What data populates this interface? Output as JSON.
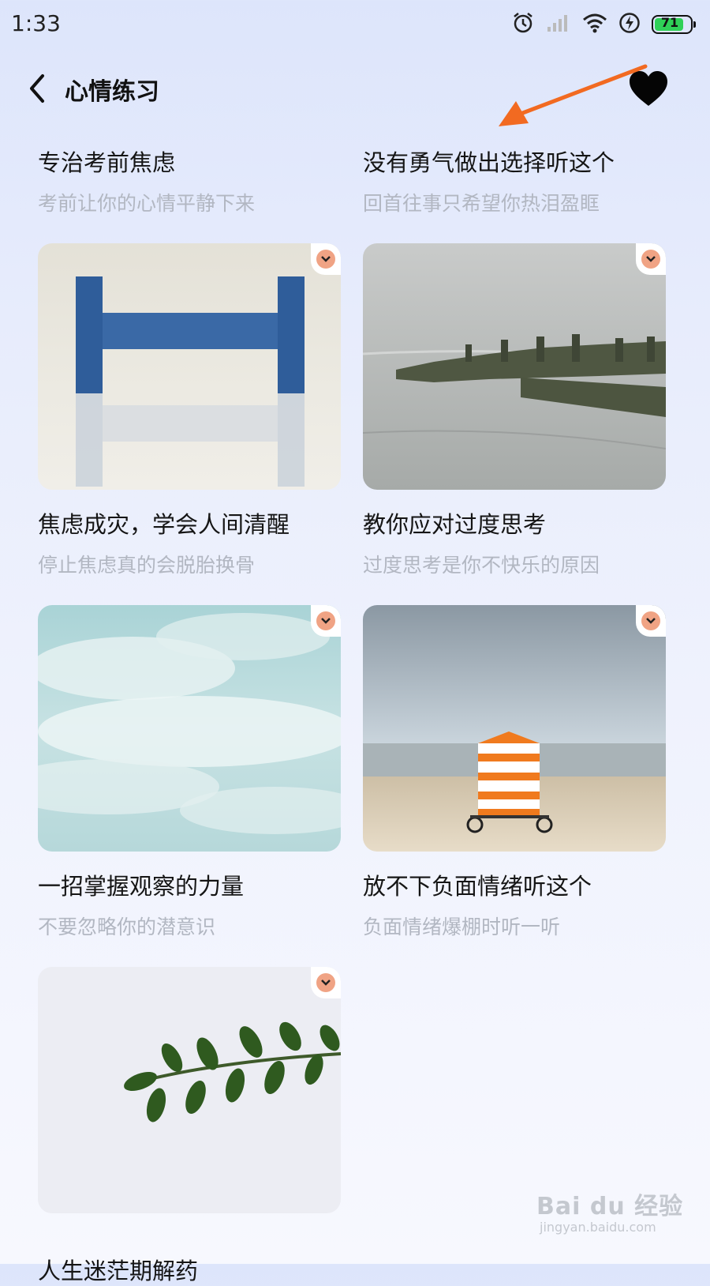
{
  "status_bar": {
    "time": "1:33",
    "battery": "71",
    "icons": [
      "alarm-icon",
      "signal-icon",
      "wifi-icon",
      "charging-icon",
      "battery-icon"
    ]
  },
  "header": {
    "title": "心情练习",
    "back_icon": "chevron-left-icon",
    "favorite_icon": "heart-icon"
  },
  "accent_colors": {
    "badge": "#f0a384",
    "annotation_arrow": "#f26a21",
    "subtitle": "#b2b7c2"
  },
  "cards": [
    {
      "title": "专治考前焦虑",
      "subtitle": "考前让你的心情平静下来"
    },
    {
      "title": "没有勇气做出选择听这个",
      "subtitle": "回首往事只希望你热泪盈眶"
    },
    {
      "title": "焦虑成灾，学会人间清醒",
      "subtitle": "停止焦虑真的会脱胎换骨",
      "image": "blue-wooden-stool"
    },
    {
      "title": "教你应对过度思考",
      "subtitle": "过度思考是你不快乐的原因",
      "image": "sea-breakwater-posts"
    },
    {
      "title": "一招掌握观察的力量",
      "subtitle": "不要忽略你的潜意识",
      "image": "cloudy-sky"
    },
    {
      "title": "放不下负面情绪听这个",
      "subtitle": "负面情绪爆棚时听一听",
      "image": "beach-hut"
    },
    {
      "title": "人生迷茫期解药",
      "image": "green-branch"
    }
  ],
  "watermark": {
    "logo": "Bai du 经验",
    "url": "jingyan.baidu.com"
  }
}
